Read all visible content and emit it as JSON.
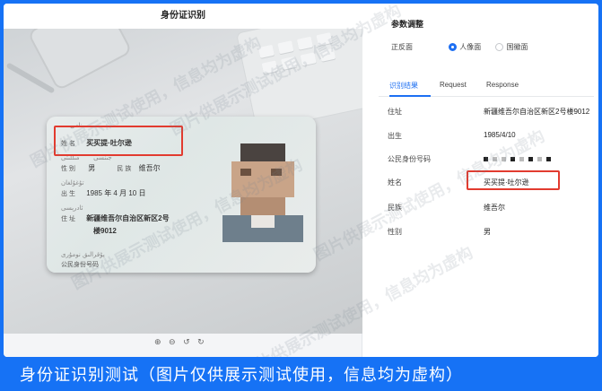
{
  "left": {
    "title": "身份证识别",
    "card": {
      "uy_name": "نامى",
      "name_label": "姓 名",
      "name": "买买提·吐尔逊",
      "gender_label": "性 别",
      "gender": "男",
      "ethnic_label": "民 族",
      "ethnic": "维吾尔",
      "birth_label": "出 生",
      "birth": "1985  年  4  月  10  日",
      "addr_label": "住 址",
      "addr_line1": "新疆维吾尔自治区新区2号",
      "addr_line2": "楼9012",
      "id_label": "公民身份号码",
      "uy_id": "پۇقرالىق نومۇرى"
    },
    "zoom_tools": "⊕ ⊖ ↺ ↻"
  },
  "right": {
    "section_title": "参数调整",
    "face_label": "正反面",
    "face_options": [
      "人像面",
      "国徽面"
    ],
    "tabs": [
      "识别结果",
      "Request",
      "Response"
    ],
    "fields": [
      {
        "label": "住址",
        "value": "新疆维吾尔自治区新区2号楼9012"
      },
      {
        "label": "出生",
        "value": "1985/4/10"
      },
      {
        "label": "公民身份号码",
        "value": ""
      },
      {
        "label": "姓名",
        "value": "买买提·吐尔逊"
      },
      {
        "label": "民族",
        "value": "维吾尔"
      },
      {
        "label": "性别",
        "value": "男"
      }
    ]
  },
  "watermark": "图片供展示测试使用，信息均为虚构",
  "caption": "身份证识别测试（图片仅供展示测试使用，信息均为虚构）",
  "colors": {
    "accent": "#1d6ff2",
    "highlight": "#e23b2f",
    "background": "#1672f5"
  }
}
